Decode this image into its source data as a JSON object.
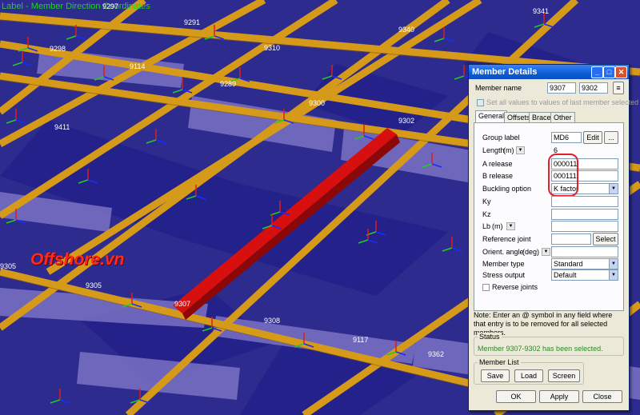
{
  "viewport": {
    "status_label": "Label - Member Direction Coordinates",
    "watermark": "Offshore.vn",
    "joint_labels": [
      "9297",
      "9291",
      "9298",
      "9310",
      "9114",
      "9289",
      "9300",
      "9411",
      "9302",
      "9305",
      "9307",
      "9308",
      "9117",
      "9362",
      "9341",
      "9340"
    ],
    "colors": {
      "background": "#2a2f8a",
      "beam": "#d59a1a",
      "selected_member": "#d80f0f",
      "axis_z": "#e21a1a",
      "axis_y": "#22cc22",
      "axis_x": "#1a2aff"
    }
  },
  "dialog": {
    "title": "Member Details",
    "member_name_label": "Member name",
    "member_name_start": "9307",
    "member_name_end": "9302",
    "set_all_label": "Set all values to values of last member selected",
    "tabs": [
      "General",
      "Offsets",
      "Brace",
      "Other"
    ],
    "general": {
      "group_label": "Group label",
      "group_value": "MD6",
      "edit_button": "Edit",
      "more_button": "...",
      "length_label": "Length",
      "length_unit": "(m)",
      "length_value": "6",
      "a_release_label": "A release",
      "a_release_value": "000011",
      "b_release_label": "B release",
      "b_release_value": "000111",
      "buckling_label": "Buckling option",
      "buckling_value": "K factor",
      "ky_label": "Ky",
      "kz_label": "Kz",
      "lb_label": "Lb",
      "lb_unit": "(m)",
      "reference_joint_label": "Reference joint",
      "select_button": "Select",
      "orient_angle_label": "Orient. angle",
      "orient_angle_unit": "(deg)",
      "member_type_label": "Member type",
      "member_type_value": "Standard",
      "stress_output_label": "Stress output",
      "stress_output_value": "Default",
      "reverse_joints_label": "Reverse joints"
    },
    "note": "Note: Enter an @ symbol in any field where that entry is to be removed for all selected members.",
    "status_title": "Status",
    "status_text": "Member 9307-9302 has been selected.",
    "member_list_title": "Member List",
    "save_button": "Save",
    "load_button": "Load",
    "screen_button": "Screen",
    "ok_button": "OK",
    "apply_button": "Apply",
    "close_button": "Close"
  }
}
